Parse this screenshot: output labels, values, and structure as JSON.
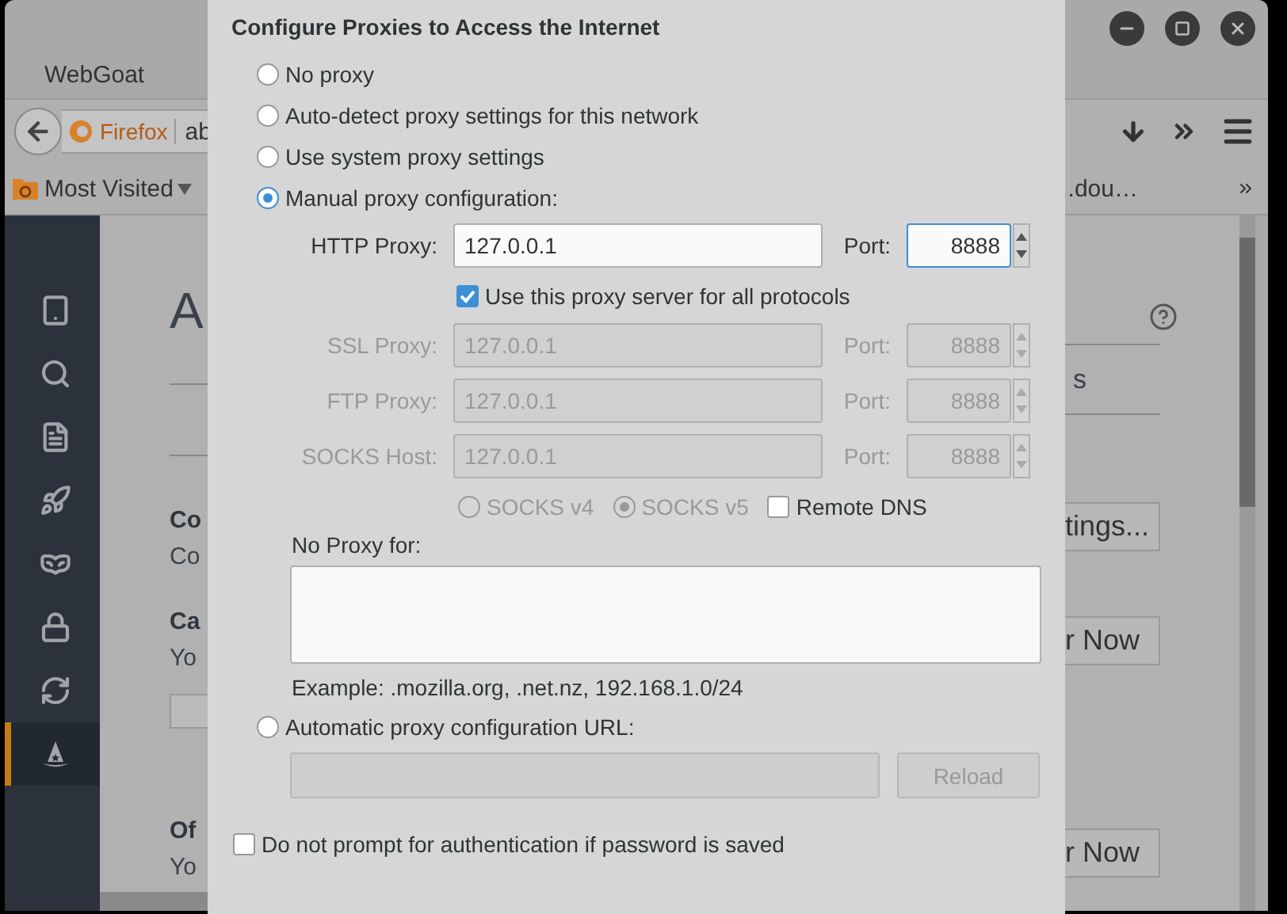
{
  "window": {
    "tab_title": "WebGoat"
  },
  "toolbar": {
    "identity": "Firefox",
    "address": "ab"
  },
  "bookmarks": {
    "folder": "Most Visited",
    "item": ".dou…"
  },
  "sidebar": {
    "items": [
      {
        "selected": false
      },
      {
        "selected": false
      },
      {
        "selected": false
      },
      {
        "selected": false
      },
      {
        "selected": false
      },
      {
        "selected": false
      },
      {
        "selected": false
      },
      {
        "selected": true
      }
    ]
  },
  "page": {
    "left": {
      "heading": "A",
      "section_1_title": "Co",
      "section_1_text": "Co",
      "section_2_title": "Ca",
      "section_2_text": "Yo",
      "section_3_title": "Of",
      "section_3_text": "Yo"
    },
    "right": {
      "tab_text": "s",
      "buttons": [
        "tings...",
        "r Now",
        "r Now"
      ]
    }
  },
  "dialog": {
    "title": "Configure Proxies to Access the Internet",
    "modes": [
      {
        "label": "No proxy",
        "selected": false
      },
      {
        "label": "Auto-detect proxy settings for this network",
        "selected": false
      },
      {
        "label": "Use system proxy settings",
        "selected": false
      },
      {
        "label": "Manual proxy configuration:",
        "selected": true
      }
    ],
    "proxies": [
      {
        "label": "HTTP Proxy:",
        "value": "127.0.0.1",
        "port_label": "Port:",
        "port": "8888",
        "disabled": false,
        "port_focused": true
      },
      {
        "label": "SSL Proxy:",
        "value": "127.0.0.1",
        "port_label": "Port:",
        "port": "8888",
        "disabled": true,
        "port_focused": false
      },
      {
        "label": "FTP Proxy:",
        "value": "127.0.0.1",
        "port_label": "Port:",
        "port": "8888",
        "disabled": true,
        "port_focused": false
      },
      {
        "label": "SOCKS Host:",
        "value": "127.0.0.1",
        "port_label": "Port:",
        "port": "8888",
        "disabled": true,
        "port_focused": false
      }
    ],
    "share_all": {
      "label": "Use this proxy server for all protocols",
      "checked": true
    },
    "socks_versions": [
      {
        "label": "SOCKS v4",
        "selected": false,
        "disabled": true
      },
      {
        "label": "SOCKS v5",
        "selected": true,
        "disabled": true
      }
    ],
    "remote_dns": {
      "label": "Remote DNS",
      "checked": false
    },
    "no_proxy": {
      "label": "No Proxy for:",
      "example": "Example: .mozilla.org, .net.nz, 192.168.1.0/24"
    },
    "auto_url": {
      "label": "Automatic proxy configuration URL:",
      "selected": false,
      "reload": "Reload",
      "disabled": true
    },
    "no_prompt": {
      "label": "Do not prompt for authentication if password is saved",
      "checked": false
    }
  }
}
